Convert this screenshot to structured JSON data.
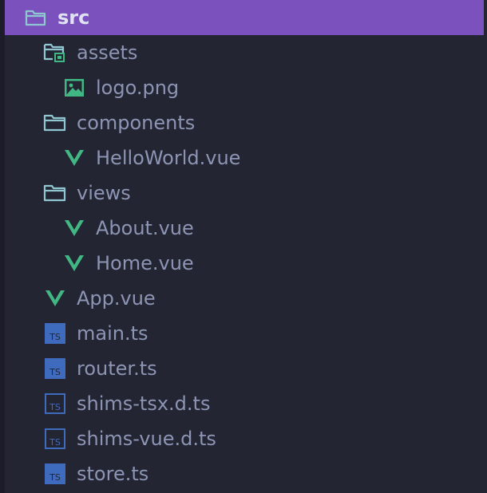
{
  "colors": {
    "background": "#242533",
    "selected_background": "#7b51bd",
    "text": "#8d95b4",
    "folder_icon": "#8ec7d2",
    "vue_icon": "#41b883",
    "ts_icon": "#3f6bbf",
    "image_icon": "#41b883"
  },
  "tree": {
    "items": [
      {
        "label": "src",
        "icon": "folder-open-icon"
      },
      {
        "label": "assets",
        "icon": "assets-folder-icon"
      },
      {
        "label": "logo.png",
        "icon": "image-icon"
      },
      {
        "label": "components",
        "icon": "folder-icon"
      },
      {
        "label": "HelloWorld.vue",
        "icon": "vue-icon"
      },
      {
        "label": "views",
        "icon": "folder-icon"
      },
      {
        "label": "About.vue",
        "icon": "vue-icon"
      },
      {
        "label": "Home.vue",
        "icon": "vue-icon"
      },
      {
        "label": "App.vue",
        "icon": "vue-icon"
      },
      {
        "label": "main.ts",
        "icon": "typescript-icon"
      },
      {
        "label": "router.ts",
        "icon": "typescript-icon"
      },
      {
        "label": "shims-tsx.d.ts",
        "icon": "typescript-declaration-icon"
      },
      {
        "label": "shims-vue.d.ts",
        "icon": "typescript-declaration-icon"
      },
      {
        "label": "store.ts",
        "icon": "typescript-icon"
      }
    ]
  }
}
